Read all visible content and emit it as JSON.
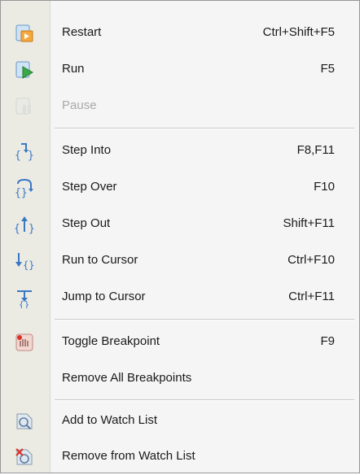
{
  "menu": {
    "items": [
      {
        "label": "Restart",
        "shortcut": "Ctrl+Shift+F5",
        "icon": "restart-icon"
      },
      {
        "label": "Run",
        "shortcut": "F5",
        "icon": "run-icon"
      },
      {
        "label": "Pause",
        "shortcut": "",
        "icon": "pause-icon",
        "disabled": true
      },
      {
        "label": "Step Into",
        "shortcut": "F8,F11",
        "icon": "step-into-icon"
      },
      {
        "label": "Step Over",
        "shortcut": "F10",
        "icon": "step-over-icon"
      },
      {
        "label": "Step Out",
        "shortcut": "Shift+F11",
        "icon": "step-out-icon"
      },
      {
        "label": "Run to Cursor",
        "shortcut": "Ctrl+F10",
        "icon": "run-to-cursor-icon"
      },
      {
        "label": "Jump to Cursor",
        "shortcut": "Ctrl+F11",
        "icon": "jump-to-cursor-icon"
      },
      {
        "label": "Toggle Breakpoint",
        "shortcut": "F9",
        "icon": "toggle-breakpoint-icon"
      },
      {
        "label": "Remove All Breakpoints",
        "shortcut": "",
        "icon": ""
      },
      {
        "label": "Add to Watch List",
        "shortcut": "",
        "icon": "add-watch-icon"
      },
      {
        "label": "Remove from Watch List",
        "shortcut": "",
        "icon": "remove-watch-icon"
      }
    ]
  },
  "colors": {
    "gutter": "#ebebe4",
    "menu_background": "#f5f5f5",
    "disabled_text": "#a9a9a9",
    "icon_blue": "#3a78c4",
    "icon_green": "#3aa845",
    "icon_orange": "#e8962a"
  }
}
